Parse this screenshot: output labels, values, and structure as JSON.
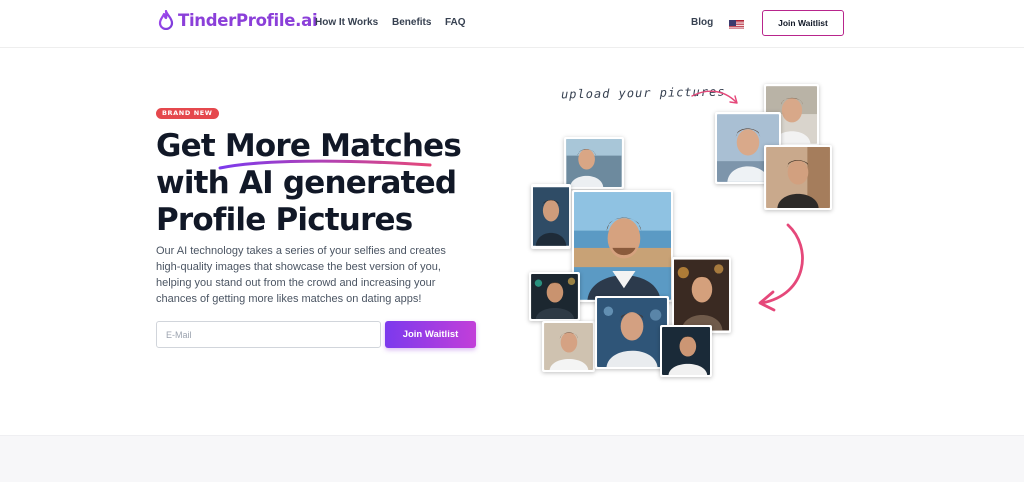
{
  "brand": {
    "name": "TinderProfile.ai",
    "color": "#8b3fd9",
    "icon": "flame-drop-icon"
  },
  "nav": {
    "links": [
      "How It Works",
      "Benefits",
      "FAQ"
    ],
    "blog": "Blog",
    "language_icon": "us-flag-icon",
    "cta": "Join Waitlist"
  },
  "hero": {
    "badge": "BRAND NEW",
    "headline": [
      "Get More Matches",
      "with AI generated",
      "Profile Pictures"
    ],
    "description": "Our AI technology takes a series of your selfies and creates high-quality images that showcase the best version of you, helping you stand out from the crowd and increasing your chances of getting more likes matches on dating apps!",
    "email_placeholder": "E-Mail",
    "email_value": "",
    "join_button": "Join Waitlist"
  },
  "collage": {
    "upload_label": "upload your pictures",
    "accent_color": "#e5487a",
    "photos": [
      "selfie-photo",
      "selfie-photo",
      "selfie-photo",
      "ai-portrait",
      "ai-portrait",
      "ai-portrait",
      "ai-portrait",
      "ai-portrait",
      "ai-portrait",
      "ai-portrait",
      "ai-portrait"
    ]
  },
  "colors": {
    "primary": "#7c3aed",
    "accent": "#c23fd9",
    "badge": "#e5484d"
  }
}
